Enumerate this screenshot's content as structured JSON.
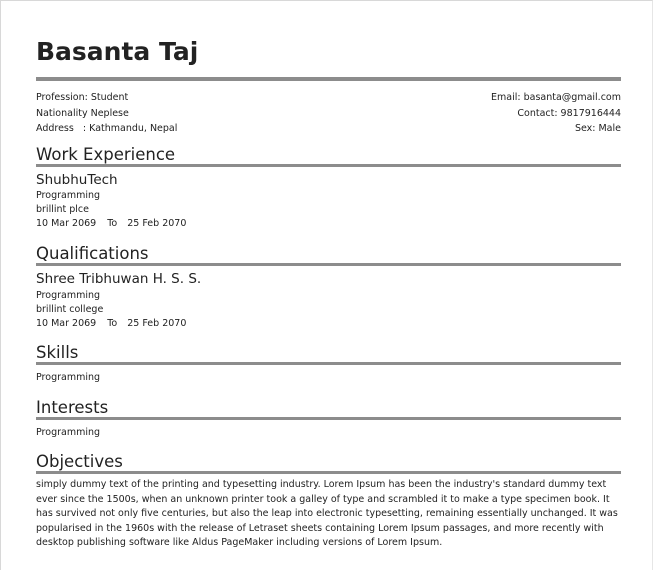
{
  "name": "Basanta Taj",
  "info": {
    "profession": "Profession: Student",
    "nationality": "Nationality Neplese",
    "address_label": "Address",
    "address_value": ": Kathmandu, Nepal",
    "email": "Email: basanta@gmail.com",
    "contact": "Contact: 9817916444",
    "sex": "Sex: Male"
  },
  "work_experience": {
    "title": "Work Experience",
    "entries": [
      {
        "org": "ShubhuTech",
        "field": "Programming",
        "remark": "brillint plce",
        "from": "10 Mar 2069",
        "to_label": "To",
        "to": "25 Feb 2070"
      }
    ]
  },
  "qualifications": {
    "title": "Qualifications",
    "entries": [
      {
        "org": "Shree Tribhuwan H. S. S.",
        "field": "Programming",
        "remark": "brillint college",
        "from": "10 Mar 2069",
        "to_label": "To",
        "to": "25 Feb 2070"
      }
    ]
  },
  "skills": {
    "title": "Skills",
    "items": [
      "Programming"
    ]
  },
  "interests": {
    "title": "Interests",
    "items": [
      "Programming"
    ]
  },
  "objectives": {
    "title": "Objectives",
    "text": "simply dummy text of the printing and typesetting industry. Lorem Ipsum has been the industry's standard dummy text ever since the 1500s, when an unknown printer took a galley of type and scrambled it to make a type specimen book. It has survived not only five centuries, but also the leap into electronic typesetting, remaining essentially unchanged. It was popularised in the 1960s with the release of Letraset sheets containing Lorem Ipsum passages, and more recently with desktop publishing software like Aldus PageMaker including versions of Lorem Ipsum."
  }
}
